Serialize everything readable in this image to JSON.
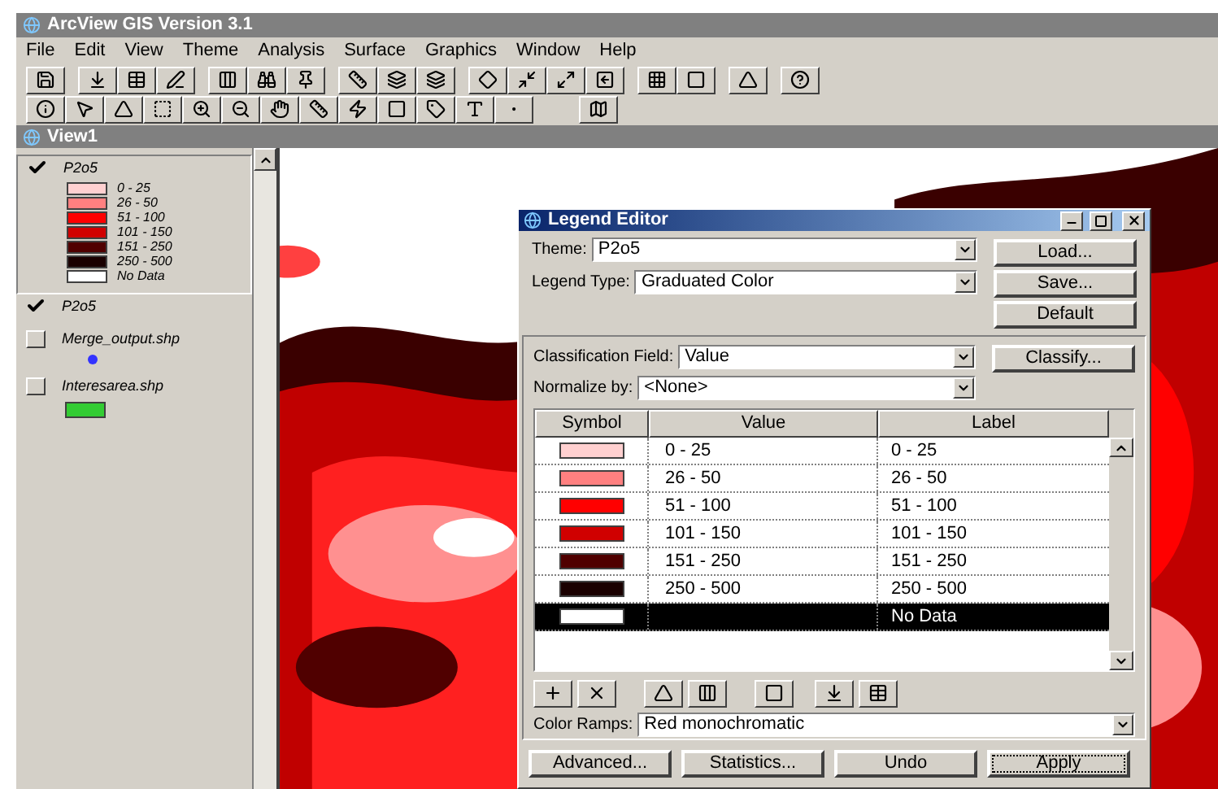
{
  "app_window": {
    "title": "ArcView GIS Version 3.1"
  },
  "menu": [
    "File",
    "Edit",
    "View",
    "Theme",
    "Analysis",
    "Surface",
    "Graphics",
    "Window",
    "Help"
  ],
  "view_window": {
    "title": "View1"
  },
  "toc": [
    {
      "kind": "legend",
      "name": "P2o5",
      "checked": true,
      "selected": true,
      "classes": [
        {
          "label": "0 - 25",
          "color": "#ffd0d0"
        },
        {
          "label": "26 - 50",
          "color": "#ff8080"
        },
        {
          "label": "51 - 100",
          "color": "#ff0000"
        },
        {
          "label": "101 - 150",
          "color": "#d00000"
        },
        {
          "label": "151 - 250",
          "color": "#500000"
        },
        {
          "label": "250 - 500",
          "color": "#1a0000"
        },
        {
          "label": "No Data",
          "color": "#ffffff"
        }
      ]
    },
    {
      "kind": "plain",
      "name": "P2o5",
      "checked": true,
      "selected": false
    },
    {
      "kind": "point",
      "name": "Merge_output.shp",
      "checked": false,
      "selected": false,
      "color": "#3333ff"
    },
    {
      "kind": "polygon",
      "name": "Interesarea.shp",
      "checked": false,
      "selected": false,
      "color": "#33cc33"
    }
  ],
  "legend_editor": {
    "title": "Legend Editor",
    "theme_label": "Theme:",
    "theme": "P2o5",
    "legend_type_label": "Legend Type:",
    "legend_type": "Graduated Color",
    "side_buttons": [
      "Load...",
      "Save...",
      "Default"
    ],
    "classification_label": "Classification Field:",
    "classification": "Value",
    "classify_button": "Classify...",
    "normalize_label": "Normalize by:",
    "normalize": "<None>",
    "columns": [
      "Symbol",
      "Value",
      "Label"
    ],
    "rows": [
      {
        "color": "#ffd0d0",
        "value": "0 - 25",
        "label": "0 - 25",
        "selected": false
      },
      {
        "color": "#ff8080",
        "value": "26 - 50",
        "label": "26 - 50",
        "selected": false
      },
      {
        "color": "#ff0000",
        "value": "51 - 100",
        "label": "51 - 100",
        "selected": false
      },
      {
        "color": "#d00000",
        "value": "101 - 150",
        "label": "101 - 150",
        "selected": false
      },
      {
        "color": "#500000",
        "value": "151 - 250",
        "label": "151 - 250",
        "selected": false
      },
      {
        "color": "#1a0000",
        "value": "250 - 500",
        "label": "250 - 500",
        "selected": false
      },
      {
        "color": "#ffffff",
        "value": "",
        "label": "No Data",
        "selected": true
      }
    ],
    "color_ramps_label": "Color Ramps:",
    "color_ramp": "Red monochromatic",
    "bottom_buttons": [
      "Advanced...",
      "Statistics...",
      "Undo",
      "Apply"
    ]
  }
}
